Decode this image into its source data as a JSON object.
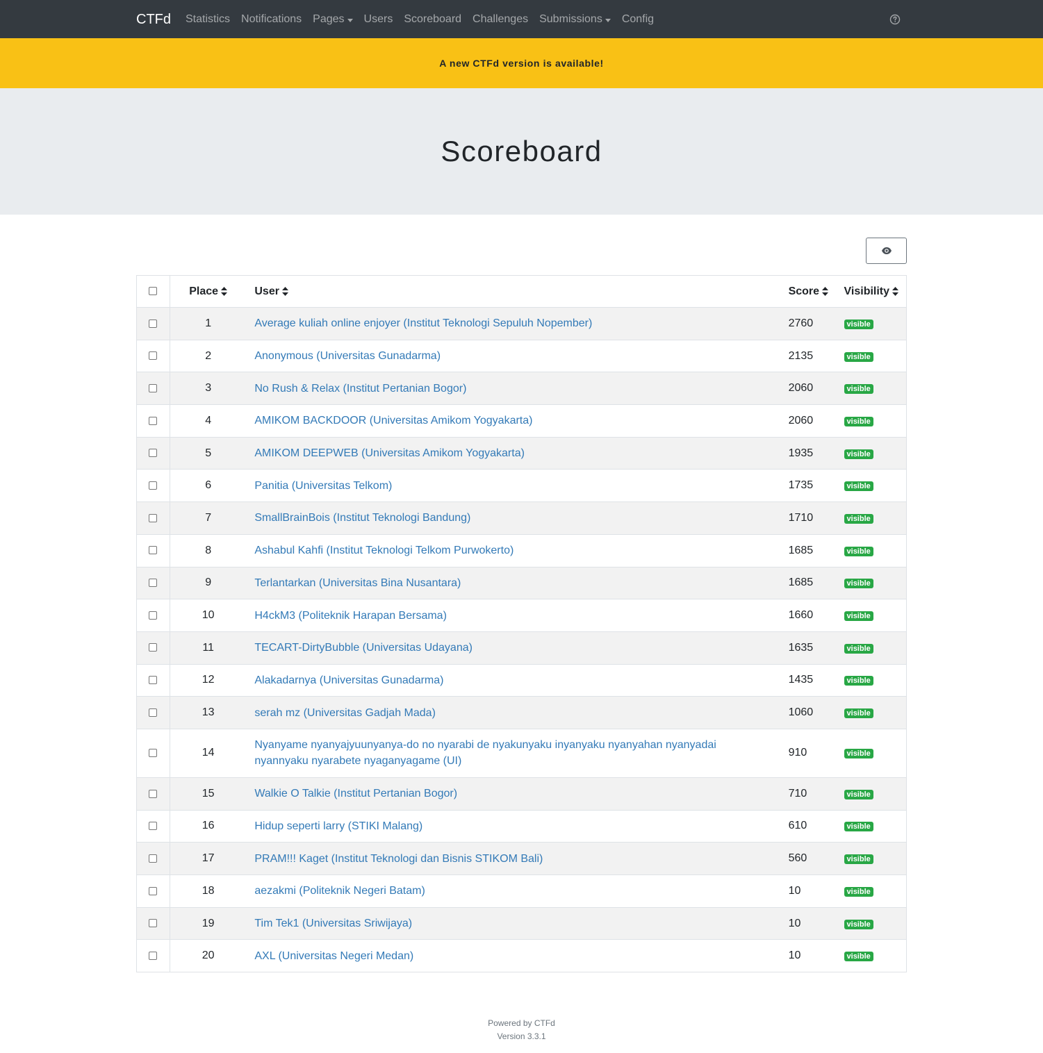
{
  "navbar": {
    "brand": "CTFd",
    "items": [
      {
        "label": "Statistics",
        "dropdown": false
      },
      {
        "label": "Notifications",
        "dropdown": false
      },
      {
        "label": "Pages",
        "dropdown": true
      },
      {
        "label": "Users",
        "dropdown": false
      },
      {
        "label": "Scoreboard",
        "dropdown": false
      },
      {
        "label": "Challenges",
        "dropdown": false
      },
      {
        "label": "Submissions",
        "dropdown": true
      },
      {
        "label": "Config",
        "dropdown": false
      }
    ],
    "help_icon": "question-circle-icon"
  },
  "banner": {
    "text": "A new CTFd version is available!",
    "color": "#f9c115"
  },
  "page": {
    "title": "Scoreboard"
  },
  "toolbar": {
    "visibility_icon": "eye-icon"
  },
  "table": {
    "headers": {
      "place": "Place",
      "user": "User",
      "score": "Score",
      "visibility": "Visibility"
    },
    "rows": [
      {
        "place": "1",
        "user": "Average kuliah online enjoyer (Institut Teknologi Sepuluh Nopember)",
        "score": "2760",
        "visibility": "visible"
      },
      {
        "place": "2",
        "user": "Anonymous (Universitas Gunadarma)",
        "score": "2135",
        "visibility": "visible"
      },
      {
        "place": "3",
        "user": "No Rush & Relax (Institut Pertanian Bogor)",
        "score": "2060",
        "visibility": "visible"
      },
      {
        "place": "4",
        "user": "AMIKOM BACKDOOR (Universitas Amikom Yogyakarta)",
        "score": "2060",
        "visibility": "visible"
      },
      {
        "place": "5",
        "user": "AMIKOM DEEPWEB (Universitas Amikom Yogyakarta)",
        "score": "1935",
        "visibility": "visible"
      },
      {
        "place": "6",
        "user": "Panitia (Universitas Telkom)",
        "score": "1735",
        "visibility": "visible"
      },
      {
        "place": "7",
        "user": "SmallBrainBois (Institut Teknologi Bandung)",
        "score": "1710",
        "visibility": "visible"
      },
      {
        "place": "8",
        "user": "Ashabul Kahfi (Institut Teknologi Telkom Purwokerto)",
        "score": "1685",
        "visibility": "visible"
      },
      {
        "place": "9",
        "user": "Terlantarkan (Universitas Bina Nusantara)",
        "score": "1685",
        "visibility": "visible"
      },
      {
        "place": "10",
        "user": "H4ckM3 (Politeknik Harapan Bersama)",
        "score": "1660",
        "visibility": "visible"
      },
      {
        "place": "11",
        "user": "TECART-DirtyBubble (Universitas Udayana)",
        "score": "1635",
        "visibility": "visible"
      },
      {
        "place": "12",
        "user": "Alakadarnya (Universitas Gunadarma)",
        "score": "1435",
        "visibility": "visible"
      },
      {
        "place": "13",
        "user": "serah mz (Universitas Gadjah Mada)",
        "score": "1060",
        "visibility": "visible"
      },
      {
        "place": "14",
        "user": "Nyanyame nyanyajyuunyanya-do no nyarabi de nyakunyaku inyanyaku nyanyahan nyanyadai nyannyaku nyarabete nyaganyagame (UI)",
        "score": "910",
        "visibility": "visible"
      },
      {
        "place": "15",
        "user": "Walkie O Talkie (Institut Pertanian Bogor)",
        "score": "710",
        "visibility": "visible"
      },
      {
        "place": "16",
        "user": "Hidup seperti larry (STIKI Malang)",
        "score": "610",
        "visibility": "visible"
      },
      {
        "place": "17",
        "user": "PRAM!!! Kaget (Institut Teknologi dan Bisnis STIKOM Bali)",
        "score": "560",
        "visibility": "visible"
      },
      {
        "place": "18",
        "user": "aezakmi (Politeknik Negeri Batam)",
        "score": "10",
        "visibility": "visible"
      },
      {
        "place": "19",
        "user": "Tim Tek1 (Universitas Sriwijaya)",
        "score": "10",
        "visibility": "visible"
      },
      {
        "place": "20",
        "user": "AXL (Universitas Negeri Medan)",
        "score": "10",
        "visibility": "visible"
      }
    ]
  },
  "footer": {
    "powered_by": "Powered by CTFd",
    "version": "Version 3.3.1"
  },
  "colors": {
    "link": "#337ab7",
    "badge": "#28a745",
    "navbar": "#343a40",
    "jumbotron": "#e9ecef"
  }
}
